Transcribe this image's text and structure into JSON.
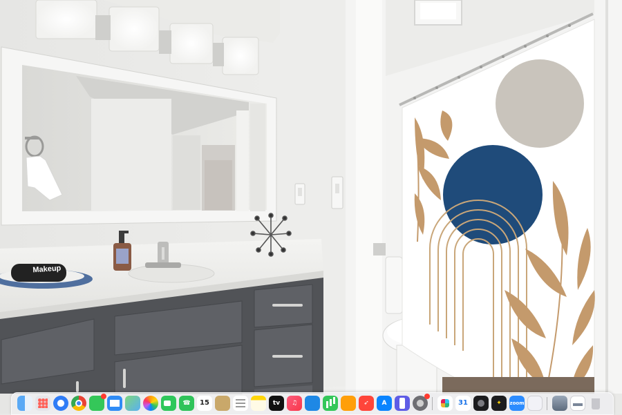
{
  "photo": {
    "towel_brand": "Makeup"
  },
  "dock": {
    "calendar_day_left": "15",
    "calendar_day_right": "31",
    "zoom_label": "zoom",
    "tv_label": "tv",
    "apps": [
      "finder",
      "launchpad",
      "safari",
      "chrome",
      "messages",
      "mail",
      "maps",
      "photos",
      "facetime",
      "phone",
      "calendar",
      "contacts",
      "reminders",
      "notes",
      "tv",
      "music",
      "keynote",
      "numbers",
      "pages",
      "rocket",
      "app-store",
      "simulator",
      "system-preferences",
      "slack",
      "calendar-2",
      "screenshot",
      "app-sparkle",
      "zoom",
      "preview",
      "desktop-window-1",
      "desktop-window-2",
      "trash"
    ]
  }
}
